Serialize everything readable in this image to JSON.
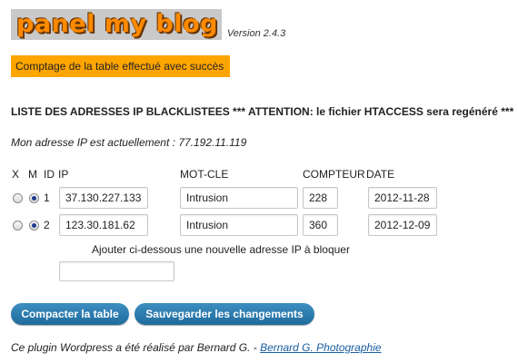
{
  "header": {
    "logo_text": "panel my blog",
    "version": "Version 2.4.3"
  },
  "notice": "Comptage de la table effectué avec succès",
  "list_title": "LISTE DES ADRESSES IP BLACKLISTEES *** ATTENTION: le fichier HTACCESS sera regénéré ***",
  "my_ip_text": "Mon adresse IP est actuellement : 77.192.11.119",
  "columns": {
    "x": "X",
    "m": "M",
    "id": "ID",
    "ip": "IP",
    "keyword": "MOT-CLE",
    "counter": "COMPTEUR",
    "date": "DATE"
  },
  "rows": [
    {
      "x_checked": false,
      "m_checked": true,
      "id": "1",
      "ip": "37.130.227.133",
      "keyword": "Intrusion",
      "counter": "228",
      "date": "2012-11-28"
    },
    {
      "x_checked": false,
      "m_checked": true,
      "id": "2",
      "ip": "123.30.181.62",
      "keyword": "Intrusion",
      "counter": "360",
      "date": "2012-12-09"
    }
  ],
  "new_ip": {
    "label": "Ajouter ci-dessous une nouvelle adresse IP à bloquer",
    "value": ""
  },
  "buttons": {
    "compact": "Compacter la table",
    "save": "Sauvegarder les changements"
  },
  "footer": {
    "text": "Ce plugin Wordpress a été réalisé par Bernard G. - ",
    "link": "Bernard G. Photographie"
  }
}
